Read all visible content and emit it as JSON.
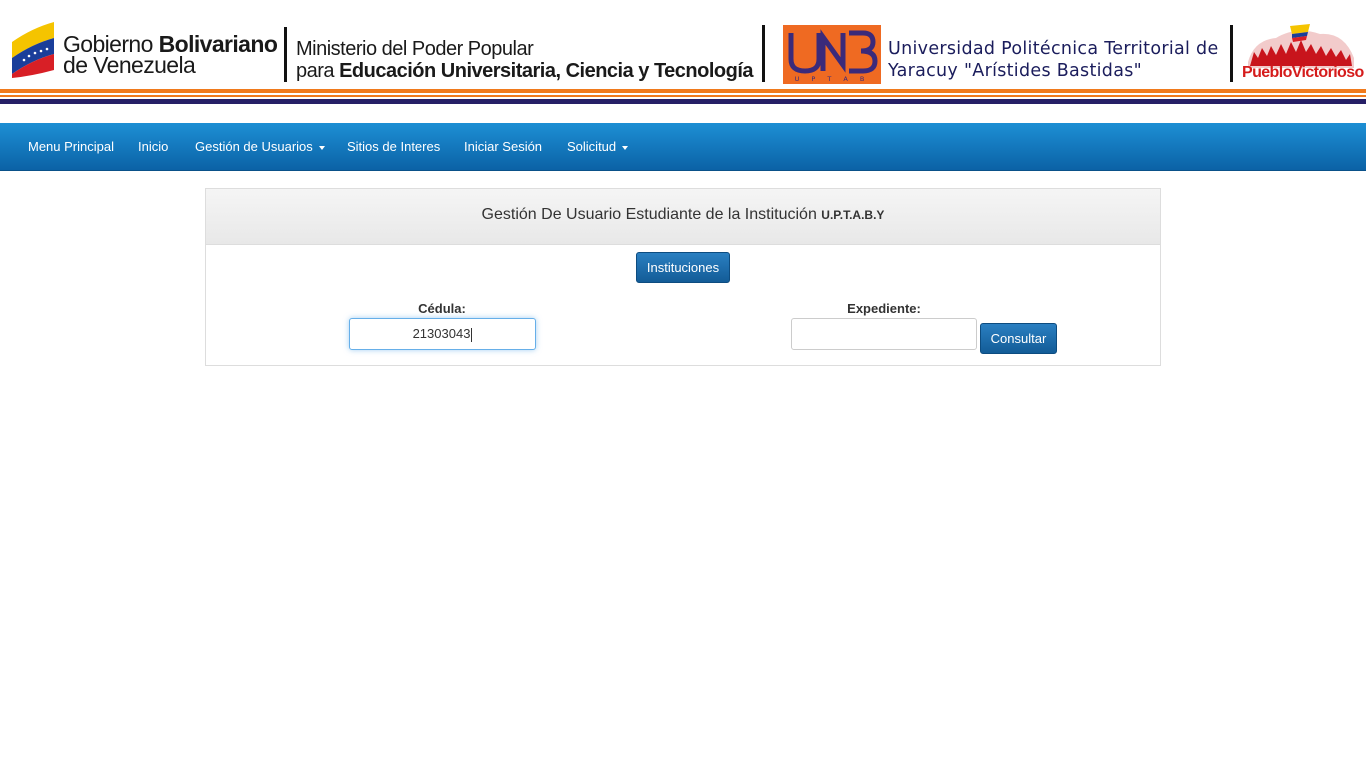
{
  "header": {
    "gobierno_line1_regular": "Gobierno ",
    "gobierno_line1_bold": "Bolivariano",
    "gobierno_line2": "de Venezuela",
    "ministerio_line1": "Ministerio del Poder Popular",
    "ministerio_line2_regular": "para ",
    "ministerio_line2_bold": "Educación Universitaria, Ciencia y Tecnología",
    "unb_logo_text": "UNB",
    "unb_logo_sub": "U P T A B",
    "universidad_line1": "Universidad Politécnica Territorial de",
    "universidad_line2": "Yaracuy \"Arístides Bastidas\"",
    "pueblo_logo_text": "PuebloVictorioso",
    "colors": {
      "orange": "#f07a1c",
      "purple": "#261f66",
      "red": "#d51c1c"
    }
  },
  "navbar": {
    "items": [
      {
        "label": "Menu Principal",
        "dropdown": false
      },
      {
        "label": "Inicio",
        "dropdown": false
      },
      {
        "label": "Gestión de Usuarios",
        "dropdown": true
      },
      {
        "label": "Sitios de Interes",
        "dropdown": false
      },
      {
        "label": "Iniciar Sesión",
        "dropdown": false
      },
      {
        "label": "Solicitud",
        "dropdown": true
      }
    ],
    "color": "#0b62a6"
  },
  "panel": {
    "title": "Gestión De Usuario Estudiante de la Institución ",
    "title_abbr": "U.P.T.A.B.Y",
    "instituciones_button": "Instituciones",
    "cedula_label": "Cédula:",
    "cedula_value": "21303043",
    "expediente_label": "Expediente:",
    "expediente_value": "",
    "consultar_button": "Consultar"
  }
}
